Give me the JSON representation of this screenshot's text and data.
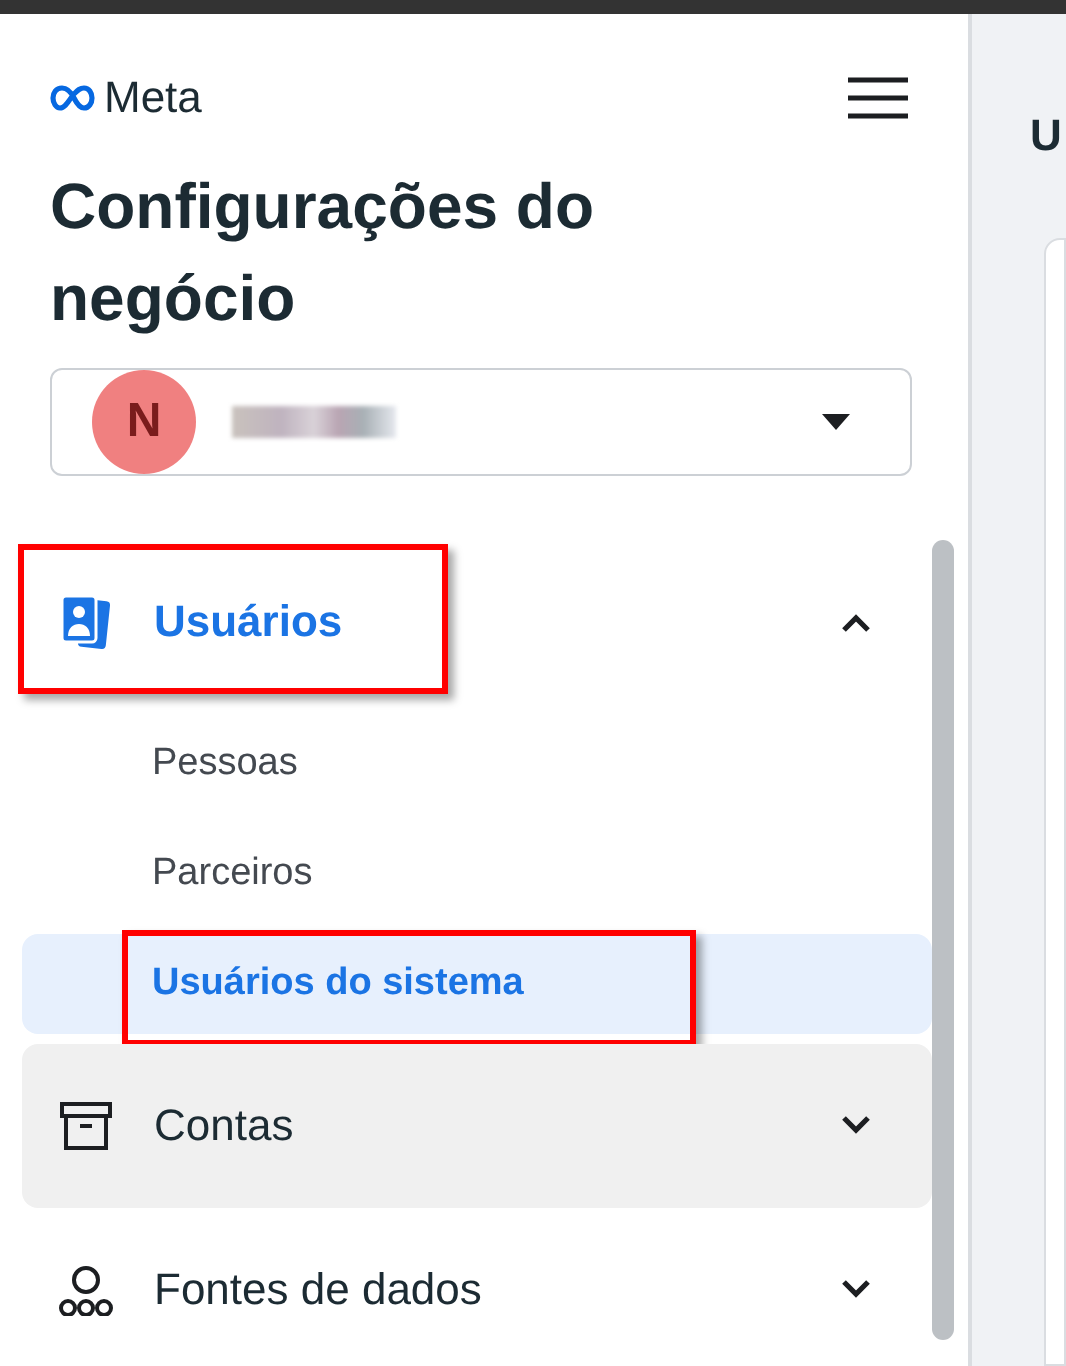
{
  "brand": {
    "name": "Meta"
  },
  "title": "Configurações do negócio",
  "account": {
    "initial": "N",
    "name_blurred": true
  },
  "sections": [
    {
      "label": "Usuários",
      "selected": true,
      "expanded": true,
      "hovered": false,
      "annotated": true,
      "children": [
        {
          "label": "Pessoas",
          "selected": false,
          "annotated": false
        },
        {
          "label": "Parceiros",
          "selected": false,
          "annotated": false
        },
        {
          "label": "Usuários do sistema",
          "selected": true,
          "annotated": true
        }
      ]
    },
    {
      "label": "Contas",
      "selected": false,
      "expanded": false,
      "hovered": true,
      "annotated": false
    },
    {
      "label": "Fontes de dados",
      "selected": false,
      "expanded": false,
      "hovered": false,
      "annotated": false
    }
  ],
  "main": {
    "heading": "U"
  }
}
